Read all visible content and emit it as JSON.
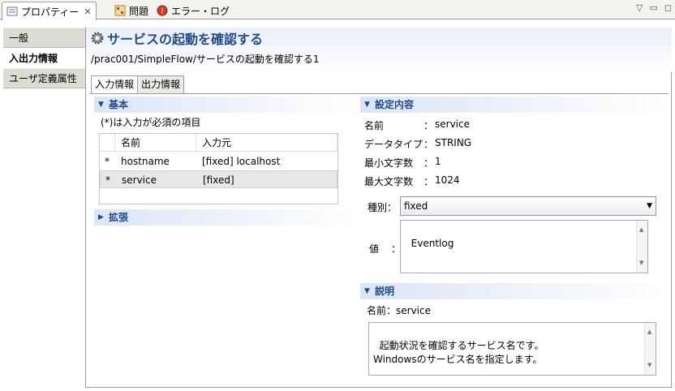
{
  "view_tabs": [
    {
      "label": "プロパティー",
      "icon": "properties-icon",
      "active": true,
      "closable": true
    },
    {
      "label": "問題",
      "icon": "problems-icon"
    },
    {
      "label": "エラー・ログ",
      "icon": "error-log-icon"
    }
  ],
  "view_controls": [
    "view-menu-icon",
    "minimize-icon",
    "maximize-icon"
  ],
  "categories": [
    "一般",
    "入出力情報",
    "ユーザ定義属性"
  ],
  "selected_category": "入出力情報",
  "page": {
    "title": "サービスの起動を確認する",
    "path": "/prac001/SimpleFlow/サービスの起動を確認する1"
  },
  "subtabs": [
    "入力情報",
    "出力情報"
  ],
  "basic_section": {
    "title": "基本",
    "required_note": "(*)は入力が必須の項目",
    "columns": [
      "名前",
      "入力元"
    ],
    "rows": [
      {
        "required": "*",
        "name": "hostname",
        "source": "[fixed] localhost"
      },
      {
        "required": "*",
        "name": "service",
        "source": "[fixed]"
      }
    ]
  },
  "extension_section": {
    "title": "拡張"
  },
  "settings_section": {
    "title": "設定内容",
    "fields": [
      {
        "label": "名前",
        "sep": "：",
        "value": "service"
      },
      {
        "label": "データタイプ",
        "sep": "：",
        "value": "STRING"
      },
      {
        "label": "最小文字数",
        "sep": "：",
        "value": "1"
      },
      {
        "label": "最大文字数",
        "sep": "：",
        "value": "1024"
      }
    ],
    "type_label": "種別：",
    "type_value": "fixed",
    "value_label": "値",
    "value_sep": "：",
    "value_text": "Eventlog"
  },
  "description_section": {
    "title": "説明",
    "name_line": "名前：service",
    "text": "起動状況を確認するサービス名です。\nWindowsのサービス名を指定します。"
  },
  "colors": {
    "accent": "#1f4a8c",
    "header_gradient": "#e8eef8",
    "nav_bg": "#dcdcd2"
  }
}
